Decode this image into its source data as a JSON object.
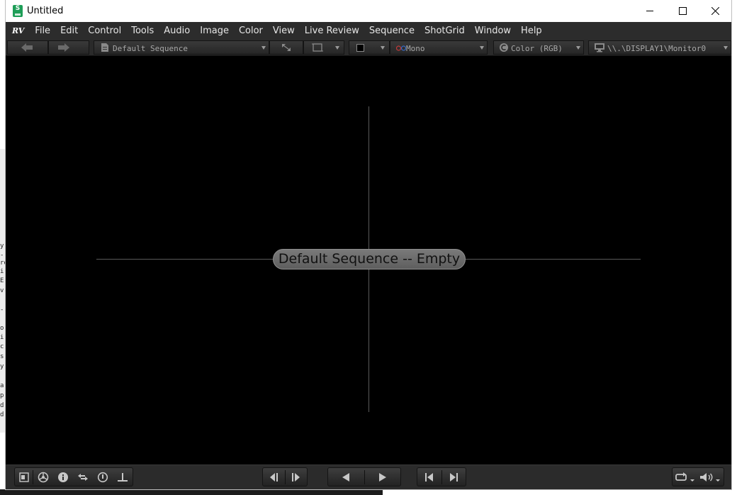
{
  "window": {
    "title": "Untitled",
    "app_icon_letter": "S"
  },
  "menubar": {
    "logo": "RV",
    "items": [
      "File",
      "Edit",
      "Control",
      "Tools",
      "Audio",
      "Image",
      "Color",
      "View",
      "Live Review",
      "Sequence",
      "ShotGrid",
      "Window",
      "Help"
    ]
  },
  "toolbar": {
    "sequence_select": "Default Sequence",
    "stereo_select": "Mono",
    "color_select": "Color (RGB)",
    "display_select": "\\\\.\\DISPLAY1\\Monitor0"
  },
  "viewport": {
    "status_label": "Default Sequence -- Empty"
  },
  "background_window": {
    "left_text_fragments": [
      "y",
      "-",
      "re",
      "i",
      "E",
      "v",
      "-",
      "o",
      "i",
      "c",
      "s",
      "y",
      "a",
      "p",
      "d",
      "d"
    ]
  },
  "colors": {
    "app_accent": "#1f9e58",
    "viewport_bg": "#000000",
    "menubar_bg": "#2c2c2c"
  }
}
